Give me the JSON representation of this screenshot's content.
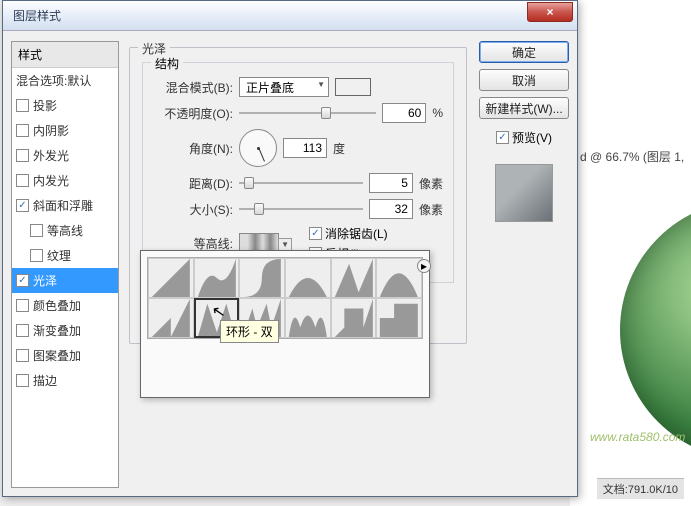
{
  "window": {
    "title": "图层样式",
    "close_glyph": "×"
  },
  "sidebar": {
    "header": "样式",
    "items": [
      {
        "label": "混合选项:默认",
        "checkbox": false,
        "checked": false
      },
      {
        "label": "投影",
        "checkbox": true,
        "checked": false
      },
      {
        "label": "内阴影",
        "checkbox": true,
        "checked": false
      },
      {
        "label": "外发光",
        "checkbox": true,
        "checked": false
      },
      {
        "label": "内发光",
        "checkbox": true,
        "checked": false
      },
      {
        "label": "斜面和浮雕",
        "checkbox": true,
        "checked": true
      },
      {
        "label": "等高线",
        "checkbox": true,
        "checked": false,
        "indent": true
      },
      {
        "label": "纹理",
        "checkbox": true,
        "checked": false,
        "indent": true
      },
      {
        "label": "光泽",
        "checkbox": true,
        "checked": true,
        "selected": true
      },
      {
        "label": "颜色叠加",
        "checkbox": true,
        "checked": false
      },
      {
        "label": "渐变叠加",
        "checkbox": true,
        "checked": false
      },
      {
        "label": "图案叠加",
        "checkbox": true,
        "checked": false
      },
      {
        "label": "描边",
        "checkbox": true,
        "checked": false
      }
    ]
  },
  "panel": {
    "group_title": "光泽",
    "struct_title": "结构",
    "blend_mode_label": "混合模式(B):",
    "blend_mode_value": "正片叠底",
    "color": "#1a8a1a",
    "opacity_label": "不透明度(O):",
    "opacity_value": "60",
    "opacity_unit": "%",
    "angle_label": "角度(N):",
    "angle_value": "113",
    "angle_unit": "度",
    "distance_label": "距离(D):",
    "distance_value": "5",
    "distance_unit": "像素",
    "size_label": "大小(S):",
    "size_value": "32",
    "size_unit": "像素",
    "contour_label": "等高线:",
    "antialias_label": "消除锯齿(L)",
    "antialias_checked": true,
    "invert_label": "反相(I)",
    "invert_checked": false
  },
  "buttons": {
    "ok": "确定",
    "cancel": "取消",
    "new_style": "新建样式(W)...",
    "preview_label": "预览(V)",
    "preview_checked": true
  },
  "popup": {
    "tooltip": "环形 - 双",
    "picker_glyph": "▸"
  },
  "background": {
    "title_info": "d @ 66.7% (图层 1,",
    "url_text": "www.rata580.com",
    "status": "文档:791.0K/10"
  }
}
